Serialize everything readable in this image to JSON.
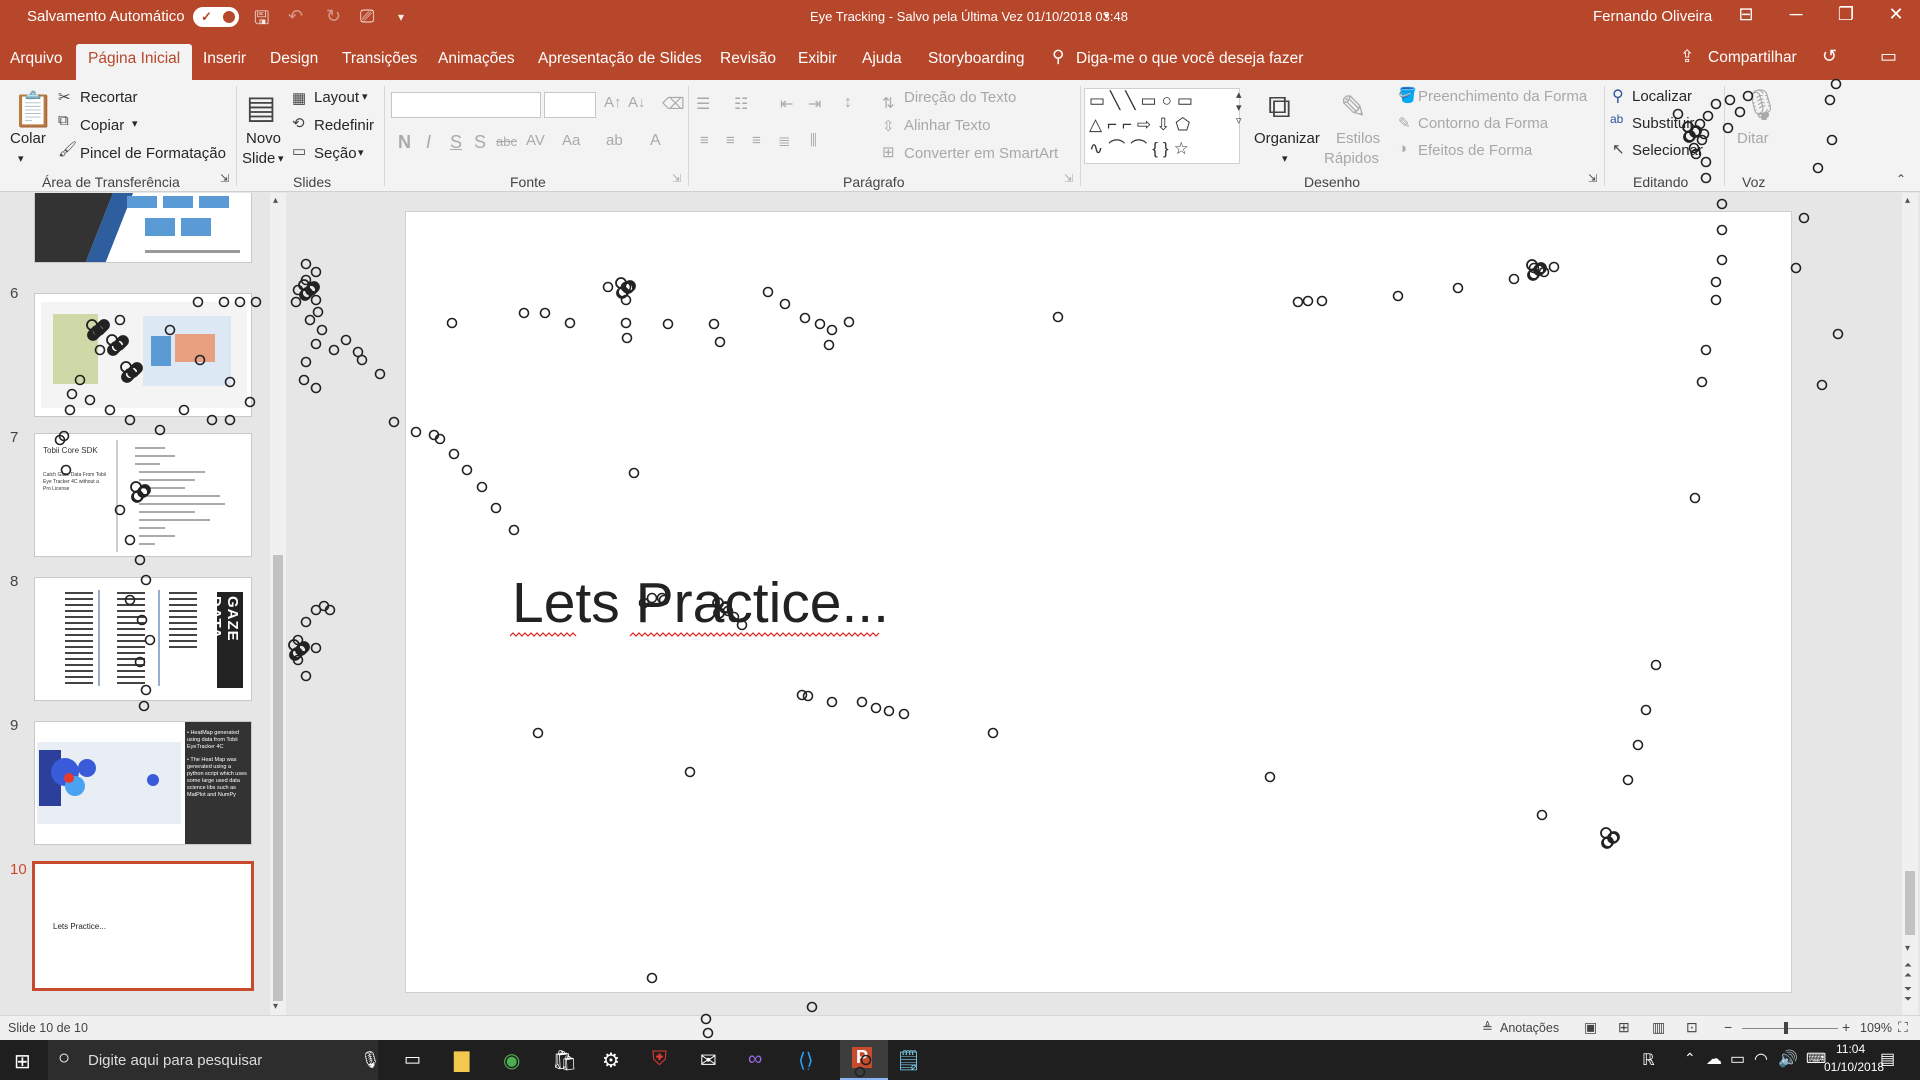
{
  "titlebar": {
    "autosave_label": "Salvamento Automático",
    "doc_title": "Eye Tracking  -  Salvo pela Última Vez 01/10/2018 03:48",
    "user_name": "Fernando Oliveira",
    "accent": "#b7472a"
  },
  "tabs": [
    {
      "label": "Arquivo"
    },
    {
      "label": "Página Inicial"
    },
    {
      "label": "Inserir"
    },
    {
      "label": "Design"
    },
    {
      "label": "Transições"
    },
    {
      "label": "Animações"
    },
    {
      "label": "Apresentação de Slides"
    },
    {
      "label": "Revisão"
    },
    {
      "label": "Exibir"
    },
    {
      "label": "Ajuda"
    },
    {
      "label": "Storyboarding"
    }
  ],
  "search": {
    "text": "Diga-me o que você deseja fazer"
  },
  "share_label": "Compartilhar",
  "ribbon": {
    "clipboard": {
      "paste": "Colar",
      "cut": "Recortar",
      "copy": "Copiar",
      "format_painter": "Pincel de Formatação",
      "group": "Área de Transferência"
    },
    "slides": {
      "new_slide_1": "Novo",
      "new_slide_2": "Slide",
      "layout": "Layout",
      "reset": "Redefinir",
      "section": "Seção",
      "group": "Slides"
    },
    "font": {
      "group": "Fonte"
    },
    "paragraph": {
      "text_direction": "Direção do Texto",
      "align_text": "Alinhar Texto",
      "smartart": "Converter em SmartArt",
      "group": "Parágrafo"
    },
    "drawing": {
      "arrange": "Organizar",
      "quick_styles_1": "Estilos",
      "quick_styles_2": "Rápidos",
      "shape_fill": "Preenchimento da Forma",
      "shape_outline": "Contorno da Forma",
      "shape_effects": "Efeitos de Forma",
      "group": "Desenho"
    },
    "editing": {
      "find": "Localizar",
      "replace": "Substituir",
      "select": "Selecionar",
      "group": "Editando"
    },
    "voice": {
      "dictate": "Ditar",
      "group": "Voz"
    }
  },
  "thumbnails": [
    {
      "num": "6"
    },
    {
      "num": "7",
      "line1": "Tobii Core SDK",
      "line2": "Catch Gaze Data From Tobii",
      "line3": "Eye Tracker 4C without a",
      "line4": "Pro License"
    },
    {
      "num": "8",
      "vertical": "GAZE DATA"
    },
    {
      "num": "9",
      "b1": "• HeatMap generated using data from Tobii EyeTracker 4C",
      "b2": "• The Heat Map was generated using a python script which uses some large used data science libs such as MatPlot and NumPy"
    },
    {
      "num": "10",
      "text": "Lets Practice..."
    }
  ],
  "slide": {
    "title": "Lets Practice..."
  },
  "status": {
    "slide_pos": "Slide 10 de 10",
    "notes": "Anotações",
    "zoom": "109%"
  },
  "taskbar": {
    "search_placeholder": "Digite aqui para pesquisar",
    "time": "11:04",
    "date": "01/10/2018"
  }
}
